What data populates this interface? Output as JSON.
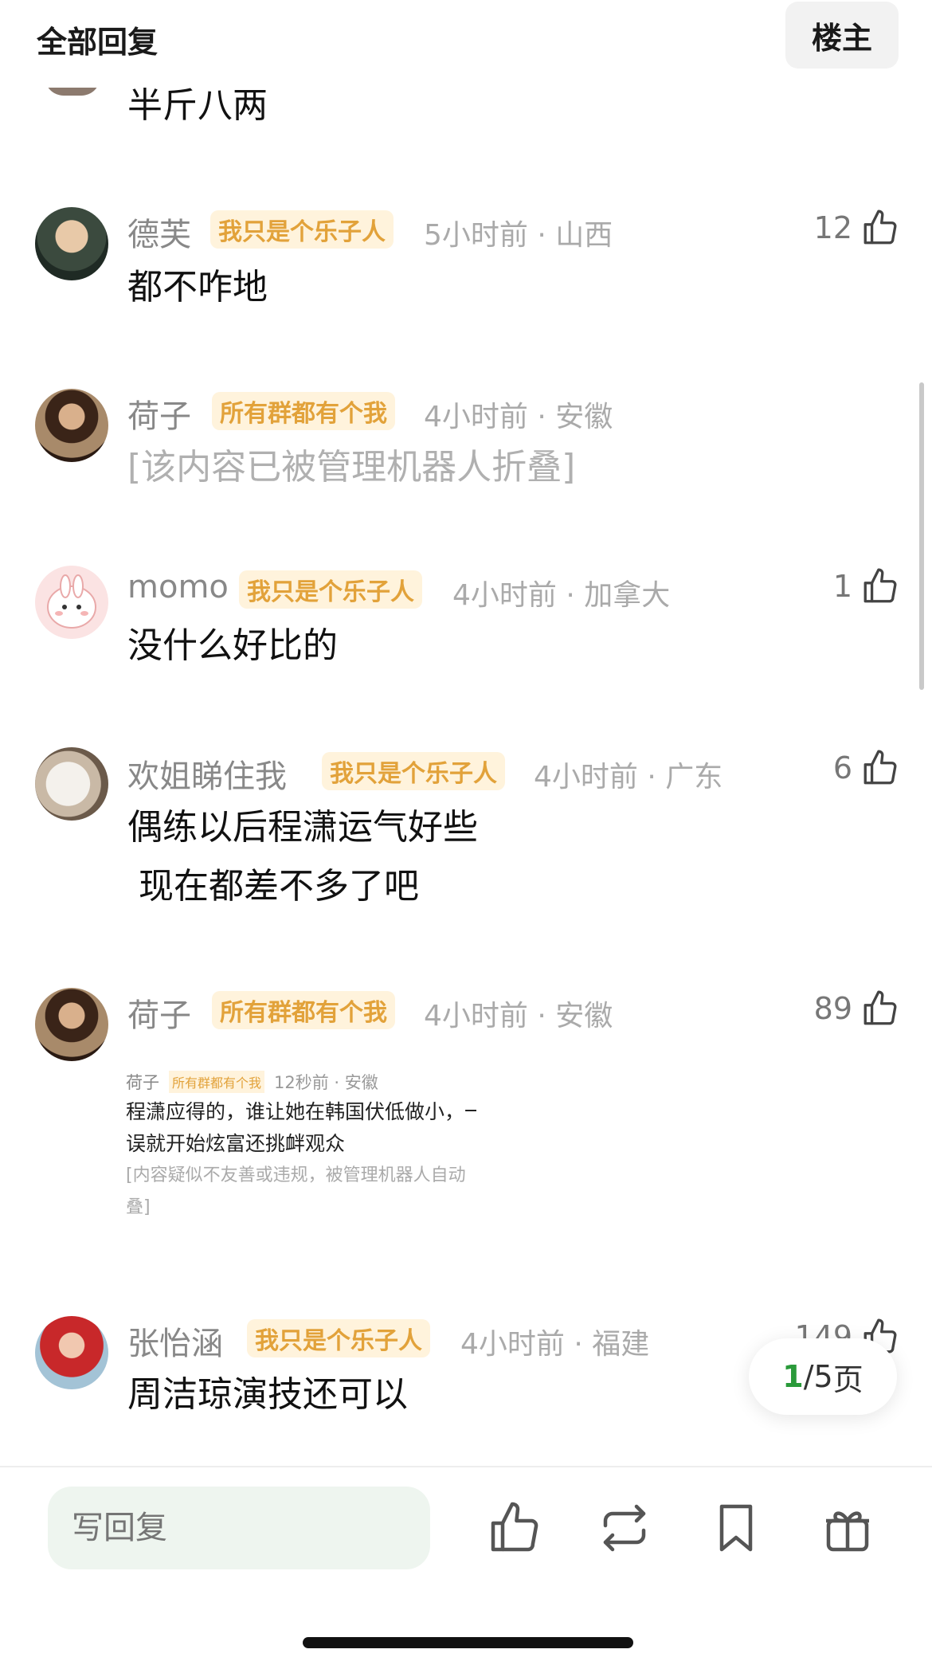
{
  "header": {
    "title": "全部回复",
    "owner_label": "楼主"
  },
  "comments": [
    {
      "content": "半斤八两"
    },
    {
      "name": "德芙",
      "badge": "我只是个乐子人",
      "meta": "5小时前 · 山西",
      "content": "都不咋地",
      "likes": "12"
    },
    {
      "name": "荷子",
      "badge": "所有群都有个我",
      "meta": "4小时前 · 安徽",
      "content": "[该内容已被管理机器人折叠]"
    },
    {
      "name": "momo",
      "badge": "我只是个乐子人",
      "meta": "4小时前 · 加拿大",
      "content": "没什么好比的",
      "likes": "1"
    },
    {
      "name": "欢姐睇住我",
      "badge": "我只是个乐子人",
      "meta": "4小时前 · 广东",
      "content": "偶练以后程潇运气好些\n 现在都差不多了吧",
      "likes": "6"
    },
    {
      "name": "荷子",
      "badge": "所有群都有个我",
      "meta": "4小时前 · 安徽",
      "likes": "89",
      "screenshot": {
        "name": "荷子",
        "badge": "所有群都有个我",
        "meta": "12秒前 · 安徽",
        "line1": "程潇应得的，谁让她在韩国伏低做小，一l",
        "line2": "误就开始炫富还挑衅观众",
        "line3": "[内容疑似不友善或违规，被管理机器人自动",
        "line4": "叠]"
      }
    },
    {
      "name": "张怡涵",
      "badge": "我只是个乐子人",
      "meta": "4小时前 · 福建",
      "content": "周洁琼演技还可以",
      "likes": "149"
    }
  ],
  "pager": {
    "current": "1",
    "total": "/5",
    "unit": "页"
  },
  "bottom_bar": {
    "reply_placeholder": "写回复"
  },
  "icons": [
    "thumbs-up-icon",
    "repost-icon",
    "bookmark-icon",
    "gift-icon"
  ],
  "colors": {
    "badge_bg": "#fff3dc",
    "badge_text": "#e2a23a",
    "page_current": "#2a9a3a",
    "input_bg": "#eef5ef"
  }
}
